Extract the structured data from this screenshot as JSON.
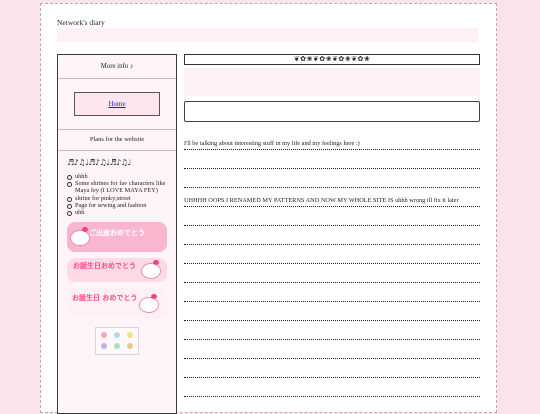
{
  "site": {
    "title": "Network's diary"
  },
  "sidebar": {
    "more_info_label": "More info ♪",
    "home_link": "Home",
    "plans_heading": "Plans for the website",
    "music_notes": "♬♪♫♩♬♪♫♩♬♪♫♩",
    "plans": [
      "uhhh",
      "Some shrines for fav characters like Maya fey (I LOVE MAYA FEY)",
      "shrine for pinky;street",
      "Page for sewing and fashion",
      "uhh"
    ],
    "stamps": [
      {
        "text": "ご出産おめでとう",
        "color": "#f9b7cf"
      },
      {
        "text": "お誕生日おめでとう",
        "color": "#ffd9e6"
      },
      {
        "text": "お誕生日 おめでとう",
        "color": "#fff0f5"
      }
    ],
    "bear_colors": [
      "#f4a6c1",
      "#b5d8f0",
      "#f7e08a",
      "#c8b0e6",
      "#a8dfb6",
      "#f7c29a"
    ]
  },
  "main": {
    "decor_border": "❦✿❀❦✿❀❦✿❀❦✿❀",
    "diary_lines": [
      "I'll be talking about interesting stuff in my life and my feelings here :)",
      "",
      "",
      "UHHHH OOPS I RENAMED MY PATTERNS AND NOW MY WHOLE SITE IS uhhh wrong ill fix it later",
      "",
      "",
      "",
      "",
      "",
      "",
      "",
      "",
      "",
      ""
    ]
  },
  "colors": {
    "background": "#fbe3ea",
    "panel": "#fff5f8",
    "link": "#1b1bd6"
  }
}
